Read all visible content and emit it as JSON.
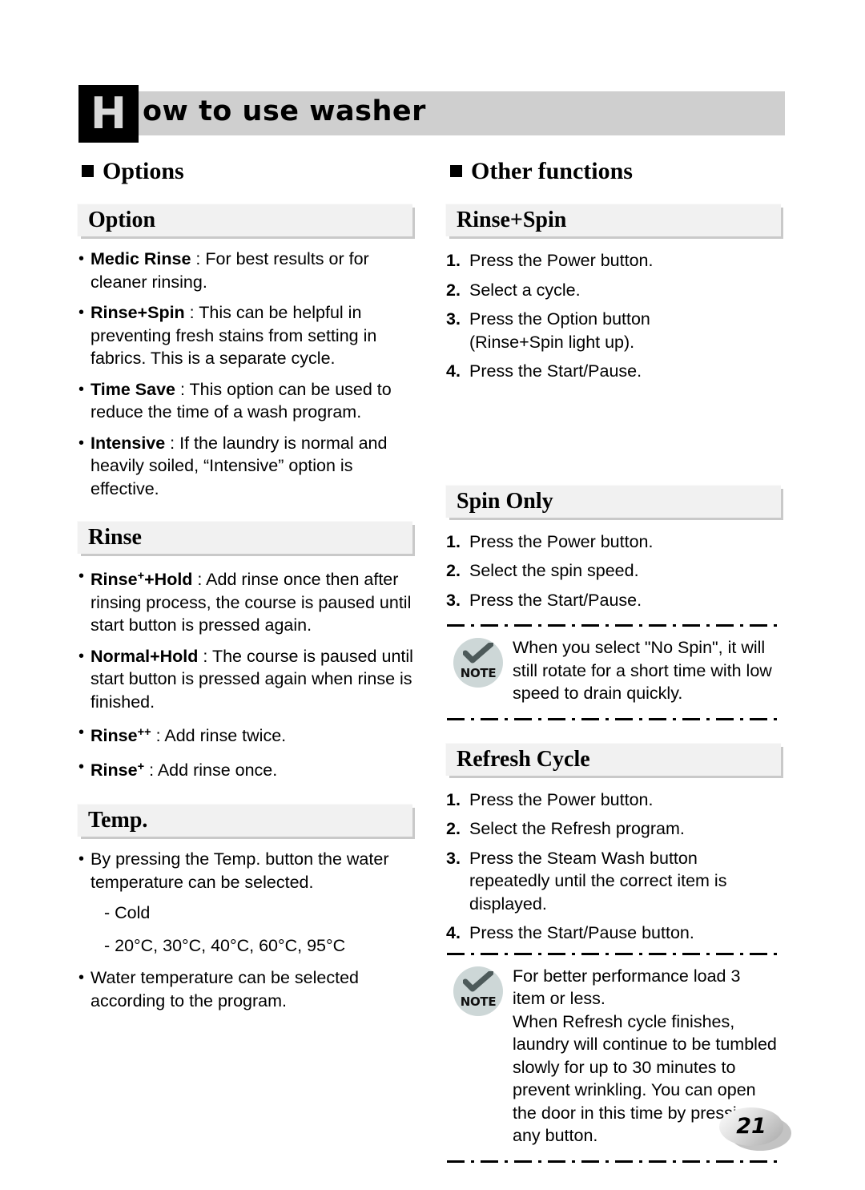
{
  "page": {
    "banner_dropcap": "H",
    "banner_title": "ow to use washer",
    "page_number": "21"
  },
  "left_column": {
    "group_heading": "Options",
    "sections": [
      {
        "title": "Option",
        "items": [
          {
            "term": "Medic Rinse",
            "sep": " : ",
            "text": "For best results or for cleaner rinsing."
          },
          {
            "term": "Rinse+Spin",
            "sep": " : ",
            "text": "This can be helpful in preventing fresh stains from setting in fabrics. This is a separate cycle."
          },
          {
            "term": "Time Save",
            "sep": " : ",
            "text": "This option can be used to reduce the time of a wash program."
          },
          {
            "term": "Intensive",
            "sep": " : ",
            "text": "If the laundry is normal and heavily soiled, “Intensive” option is effective."
          }
        ]
      },
      {
        "title": "Rinse",
        "items": [
          {
            "term": "Rinse",
            "sup": "+",
            "term_tail": "+Hold",
            "sep": " : ",
            "text": "Add rinse once then after rinsing process, the course is paused until start button is pressed again."
          },
          {
            "term": "Normal+Hold",
            "sep": " : ",
            "text": "The course is paused until start button is pressed again when rinse is finished."
          },
          {
            "term": "Rinse",
            "sup": "++",
            "term_tail": "",
            "sep": " : ",
            "text": "Add rinse twice."
          },
          {
            "term": "Rinse",
            "sup": "+",
            "term_tail": "",
            "sep": " : ",
            "text": "Add rinse once."
          }
        ]
      },
      {
        "title": "Temp.",
        "items": [
          {
            "term": "",
            "sep": "",
            "text": "By pressing the Temp. button the water temperature can be selected."
          },
          {
            "plain": true,
            "text": "- Cold"
          },
          {
            "plain": true,
            "text": "- 20°C, 30°C, 40°C, 60°C, 95°C"
          },
          {
            "term": "",
            "sep": "",
            "text": "Water temperature can be selected according to the program."
          }
        ]
      }
    ]
  },
  "right_column": {
    "group_heading": "Other functions",
    "sections": [
      {
        "title": "Rinse+Spin",
        "steps": [
          {
            "num": "1.",
            "lines": [
              "Press the Power button."
            ]
          },
          {
            "num": "2.",
            "lines": [
              "Select a cycle."
            ]
          },
          {
            "num": "3.",
            "lines": [
              "Press the Option button",
              "(Rinse+Spin light up)."
            ]
          },
          {
            "num": "4.",
            "lines": [
              "Press the Start/Pause."
            ]
          }
        ]
      },
      {
        "title": "Spin Only",
        "steps": [
          {
            "num": "1.",
            "lines": [
              "Press the Power button."
            ]
          },
          {
            "num": "2.",
            "lines": [
              "Select the spin speed."
            ]
          },
          {
            "num": "3.",
            "lines": [
              "Press the Start/Pause."
            ]
          }
        ],
        "note": {
          "badge_label": "NOTE",
          "lines": [
            "When you select \"No Spin\", it will",
            "still rotate for a short time with low",
            "speed to drain quickly."
          ]
        }
      },
      {
        "title": "Refresh Cycle",
        "steps": [
          {
            "num": "1.",
            "lines": [
              "Press the Power button."
            ]
          },
          {
            "num": "2.",
            "lines": [
              "Select the Refresh program."
            ]
          },
          {
            "num": "3.",
            "lines": [
              "Press the Steam Wash button",
              "repeatedly until the correct item is",
              "displayed."
            ]
          },
          {
            "num": "4.",
            "lines": [
              "Press the Start/Pause button."
            ]
          }
        ],
        "note": {
          "badge_label": "NOTE",
          "lines": [
            "For better performance load 3",
            "item or less.",
            "When Refresh cycle finishes,",
            "laundry will continue to be tumbled",
            "slowly for up to 30 minutes to",
            "prevent wrinkling. You can open",
            "the door in this time by pressing",
            "any button."
          ]
        }
      }
    ]
  }
}
